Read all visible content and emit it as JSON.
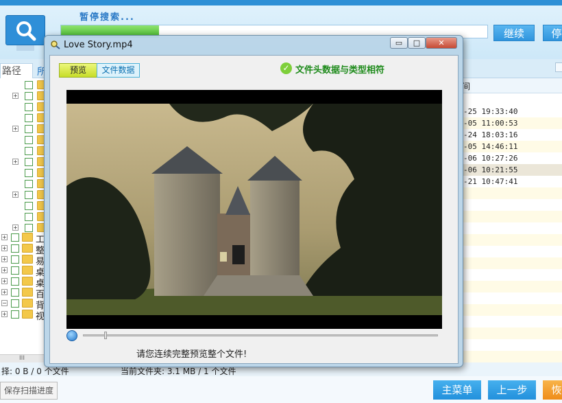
{
  "app": {
    "status_text": "暂停搜索...",
    "progress_percent": 23,
    "continue_label": "继续",
    "stop_label": "停",
    "tab_path_label": "路径",
    "tab_other_label": "所",
    "tree_labels": [
      "工",
      "整",
      "易",
      "桌",
      "桌",
      "百",
      "背",
      "视"
    ],
    "list_times": [
      "-25 19:33:40",
      "-05 11:00:53",
      "-24 18:03:16",
      "-05 14:46:11",
      "-06 10:27:26",
      "-06 10:21:55",
      "-21 10:47:41"
    ],
    "list_head_label": "间",
    "status_select": "择: 0 B / 0 个文件",
    "status_current": "当前文件夹: 3.1 MB / 1 个文件",
    "scroll_label": "III",
    "save_label": "保存扫描进度",
    "main_menu_label": "主菜单",
    "prev_label": "上一步",
    "next_label": "恢"
  },
  "dialog": {
    "title": "Love Story.mp4",
    "min_label": "▭",
    "max_label": "□",
    "close_label": "✕",
    "tab_preview": "预览",
    "tab_filedata": "文件数据",
    "match_text": "文件头数据与类型相符",
    "hint": "请您连续完整预览整个文件!",
    "playback_position": 0.06,
    "colors": {
      "match": "#1d8a1a",
      "progress": "#43b52c",
      "accent": "#2f95de"
    }
  }
}
